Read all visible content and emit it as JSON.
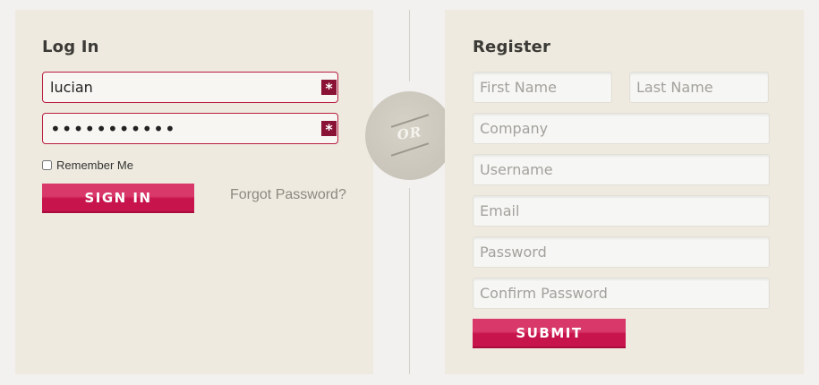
{
  "login": {
    "title": "Log In",
    "username_value": "lucian",
    "password_value": "lucian12345",
    "required_marker": "*",
    "remember_label": "Remember Me",
    "sign_in_label": "SIGN IN",
    "forgot_label": "Forgot Password?"
  },
  "divider": {
    "or_label": "OR"
  },
  "register": {
    "title": "Register",
    "first_name_placeholder": "First Name",
    "last_name_placeholder": "Last Name",
    "company_placeholder": "Company",
    "username_placeholder": "Username",
    "email_placeholder": "Email",
    "password_placeholder": "Password",
    "confirm_password_placeholder": "Confirm Password",
    "submit_label": "SUBMIT"
  },
  "colors": {
    "accent": "#c8144d",
    "required_badge": "#8a1234",
    "panel_background": "#eeeadf"
  }
}
